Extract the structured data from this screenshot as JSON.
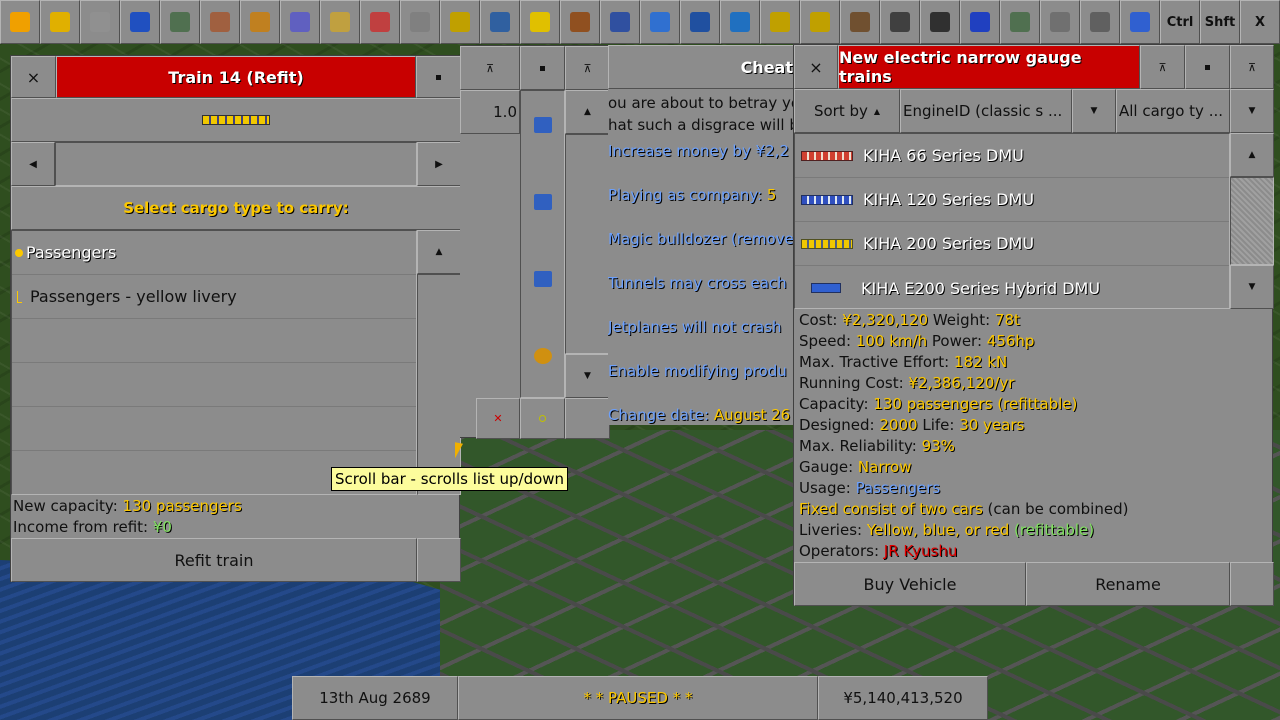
{
  "toolbar": {
    "ctrl": "Ctrl",
    "shift": "Shft",
    "close": "X",
    "icons": [
      "pause-icon",
      "fast-forward-icon",
      "settings-icon",
      "save-icon",
      "map-icon",
      "town-icon",
      "subsidies-icon",
      "stations-icon",
      "finances-icon",
      "company-icon",
      "story-icon",
      "goals-icon",
      "graphs-icon",
      "league-icon",
      "industry-icon",
      "train-icon",
      "road-vehicle-icon",
      "ship-icon",
      "aircraft-icon",
      "zoom-in-icon",
      "zoom-out-icon",
      "build-rail-icon",
      "build-road-icon",
      "build-tram-icon",
      "build-water-icon",
      "landscape-icon",
      "music-icon",
      "news-icon",
      "help-icon"
    ]
  },
  "refit": {
    "close": "×",
    "title": "Train 14 (Refit)",
    "select_label": "Select cargo type to carry:",
    "cargo_group": "Passengers",
    "cargo_item": "Passengers - yellow livery",
    "capacity_label": "New capacity: ",
    "capacity_value": "130 passengers",
    "income_label": "Income from refit: ",
    "income_value": "¥0",
    "refit_button": "Refit train"
  },
  "tooltip": "Scroll bar - scrolls list up/down",
  "cheat": {
    "title": "Cheat",
    "value": "1.0",
    "lines": [
      "ou are about to betray your",
      "hat such a disgrace will b"
    ],
    "items": [
      {
        "label": "Increase money by ¥2,2",
        "value": ""
      },
      {
        "label": "Playing as company: ",
        "value": "5"
      },
      {
        "label": "Magic bulldozer (remove",
        "value": ""
      },
      {
        "label": "Tunnels may cross each",
        "value": ""
      },
      {
        "label": "Jetplanes will not crash",
        "value": ""
      },
      {
        "label": "Enable modifying produ",
        "value": ""
      },
      {
        "label": "Change date: ",
        "value": "August 26"
      }
    ]
  },
  "build": {
    "close": "×",
    "title": "New electric narrow gauge trains",
    "sort_label": "Sort by",
    "sort_value": "EngineID (classic s ...",
    "cargo_filter": "All cargo ty ...",
    "engines": [
      "KIHA 66 Series DMU",
      "KIHA 120 Series DMU",
      "KIHA 200 Series DMU",
      "KIHA E200 Series Hybrid DMU"
    ],
    "details": [
      [
        {
          "t": "Cost: ",
          "c": ""
        },
        {
          "t": "¥2,320,120",
          "c": "yel"
        },
        {
          "t": " Weight: ",
          "c": ""
        },
        {
          "t": "78t",
          "c": "yel"
        }
      ],
      [
        {
          "t": "Speed: ",
          "c": ""
        },
        {
          "t": "100 km/h",
          "c": "yel"
        },
        {
          "t": " Power: ",
          "c": ""
        },
        {
          "t": "456hp",
          "c": "yel"
        }
      ],
      [
        {
          "t": "Max. Tractive Effort: ",
          "c": ""
        },
        {
          "t": "182 kN",
          "c": "yel"
        }
      ],
      [
        {
          "t": "Running Cost: ",
          "c": ""
        },
        {
          "t": "¥2,386,120/yr",
          "c": "yel"
        }
      ],
      [
        {
          "t": "Capacity: ",
          "c": ""
        },
        {
          "t": "130 passengers (refittable)",
          "c": "yel"
        }
      ],
      [
        {
          "t": "Designed: ",
          "c": ""
        },
        {
          "t": "2000",
          "c": "yel"
        },
        {
          "t": " Life: ",
          "c": ""
        },
        {
          "t": "30 years",
          "c": "yel"
        }
      ],
      [
        {
          "t": "Max. Reliability: ",
          "c": ""
        },
        {
          "t": "93%",
          "c": "yel"
        }
      ],
      [
        {
          "t": "Gauge: ",
          "c": ""
        },
        {
          "t": "Narrow",
          "c": "yel"
        }
      ],
      [
        {
          "t": "Usage: ",
          "c": ""
        },
        {
          "t": "Passengers",
          "c": "blue"
        }
      ],
      [
        {
          "t": "Fixed consist of two cars",
          "c": "yel"
        },
        {
          "t": " (can be combined)",
          "c": ""
        }
      ],
      [
        {
          "t": "Liveries:  ",
          "c": ""
        },
        {
          "t": "Yellow, blue, or red",
          "c": "yel"
        },
        {
          "t": " (refittable)",
          "c": "green"
        }
      ],
      [
        {
          "t": "Operators: ",
          "c": ""
        },
        {
          "t": "JR Kyushu",
          "c": "red"
        }
      ]
    ],
    "buy_button": "Buy Vehicle",
    "rename_button": "Rename"
  },
  "status": {
    "date": "13th Aug 2689",
    "paused": "* *  PAUSED  * *",
    "money": "¥5,140,413,520"
  }
}
